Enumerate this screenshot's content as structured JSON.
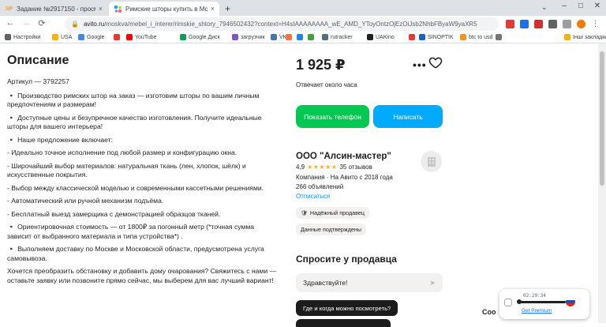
{
  "browser": {
    "tabs": [
      {
        "favicon": "SP",
        "favicon_color": "#e8a33d",
        "title": "Задание №2917150 - просмотр",
        "close": "×"
      },
      {
        "favicon": "avito",
        "favicon_color": "#0af",
        "title": "Римские шторы купить в Моск...",
        "close": "×"
      }
    ],
    "new_tab": "+",
    "tab_search_icon": "⌄",
    "window_controls": {
      "minimize": "–",
      "maximize": "□",
      "close": "✕"
    },
    "nav": {
      "back": "←",
      "forward": "→",
      "reload": "⟳"
    },
    "url_host": "avito.ru",
    "url_path": "/moskva/mebel_i_interer/rimskie_shtory_7946502432?context=H4sIAAAAAAAA_wE_AMD_YToyOntzOjEzOiJsb2NhbFByaW9yaXR5",
    "bookmarks": [
      {
        "label": "Настройки",
        "color": "#5f6368"
      },
      {
        "label": "USA",
        "color": "#f4b400"
      },
      {
        "label": "Google",
        "color": "#4285f4"
      },
      {
        "label": "",
        "color": "#e53935"
      },
      {
        "label": "YouTube",
        "color": "#ff0000"
      },
      {
        "label": "Google Диск",
        "color": "#0f9d58"
      },
      {
        "label": "загрузчик",
        "color": "#7e57c2"
      },
      {
        "label": "VK",
        "color": "#4a76a8"
      },
      {
        "label": "",
        "color": "#ff7043"
      },
      {
        "label": "",
        "color": "#1e88e5"
      },
      {
        "label": "",
        "color": "#43a047"
      },
      {
        "label": "rutracker",
        "color": "#546e7a"
      },
      {
        "label": "UAKino",
        "color": "#212121"
      },
      {
        "label": "",
        "color": "#e53935"
      },
      {
        "label": "SINOPTIK",
        "color": "#1565c0"
      },
      {
        "label": "btc to usd",
        "color": "#f7931a"
      },
      {
        "label": "",
        "color": "#757575"
      },
      {
        "label": "Інші закладки",
        "color": "#f4b400"
      }
    ]
  },
  "description": {
    "title": "Описание",
    "article": "Артикул — 3792257",
    "paragraphs": [
      "▪️ Производство римских штор на заказ — изготовим шторы по вашим личным предпочтениям и размерам!",
      "▪️ Доступные цены и безупречное качество изготовления. Получите идеальные шторы для вашего интерьера!",
      "▪️ Наше предложение включает:",
      "- Идеально точное исполнение под любой размер и конфигурацию окна.",
      "- Широчайший выбор материалов: натуральная ткань (лен, хлопок, шёлк) и искусственные покрытия.",
      "- Выбор между классической моделью и современными кассетными решениями.",
      "- Автоматический или ручной механизм подъёма.",
      "- Бесплатный выезд замерщика с демонстрацией образцов тканей.",
      "▪️ Ориентировочная стоимость — от 1800₽ за погонный метр (*точная сумма зависит от выбранного материала и типа устройства*) .",
      "▪️ Выполняем доставку по Москве и Московской области, предусмотрена услуга самовывоза.",
      "Хочется преобразить обстановку и добавить дому очарования? Свяжитесь с нами — оставьте заявку или позвоните прямо сейчас, мы выберем для вас лучший вариант!"
    ]
  },
  "listing": {
    "price": "1 925 ₽",
    "more": "•••",
    "answers": "Отвечает около часа",
    "phone_button": "Показать телефон",
    "write_button": "Написать",
    "seller_name": "ООО \"Алсин-мастер\"",
    "rating_value": "4,9",
    "stars": "★★★★★",
    "reviews": "35 отзывов",
    "company_meta": "Компания · На Авито с 2018 года",
    "listings_count": "266 объявлений",
    "unsubscribe": "Отписаться",
    "badge_reliable": "Надёжный продавец",
    "badge_verified": "Данные подтверждены",
    "ask_title": "Спросите у продавца",
    "ask_input_value": "Здравствуйте!",
    "question_chip": "Где и когда можно посмотреть?"
  },
  "widgets": {
    "recorder_text": "Coo",
    "player_time": "02:29:34",
    "get_premium": "Get Premium"
  }
}
